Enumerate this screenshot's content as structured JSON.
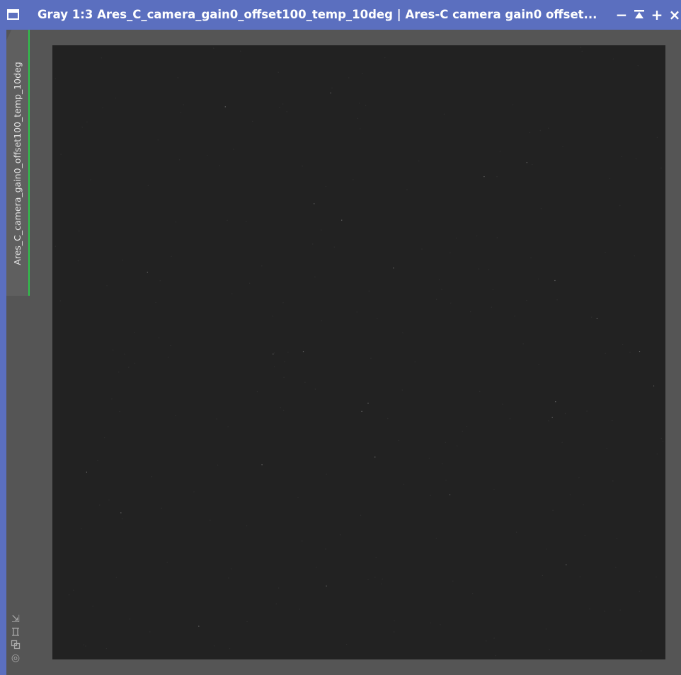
{
  "window": {
    "title": "Gray 1:3 Ares_C_camera_gain0_offset100_temp_10deg | Ares-C camera gain0 offset...",
    "icon": "window-menu-icon",
    "buttons": {
      "minimize_glyph": "−",
      "shade_glyph": "⏶",
      "maximize_glyph": "+",
      "close_glyph": "×"
    },
    "colors": {
      "titlebar": "#5b6fbf",
      "tab_accent": "#2ec44a",
      "image_background": "#222222",
      "workspace": "#555555"
    }
  },
  "side_tab": {
    "label": "Ares_C_camera_gain0_offset100_temp_10deg"
  },
  "side_icons": [
    {
      "name": "fit-view-icon",
      "glyph": "⇲"
    },
    {
      "name": "zoom-to-fit-icon",
      "glyph": "⌗"
    },
    {
      "name": "clone-view-icon",
      "glyph": "⧉"
    },
    {
      "name": "target-icon",
      "glyph": "◎"
    }
  ]
}
